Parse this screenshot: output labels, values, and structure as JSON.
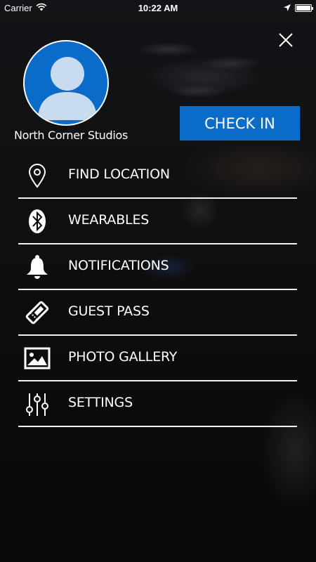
{
  "status_bar": {
    "carrier": "Carrier",
    "time": "10:22 AM",
    "battery_level": 1.0
  },
  "profile": {
    "studio_name": "North Corner Studios",
    "avatar_icon": "user-avatar-icon"
  },
  "actions": {
    "check_in_label": "CHECK IN",
    "close_icon": "close-icon"
  },
  "menu": {
    "items": [
      {
        "label": "FIND LOCATION",
        "icon": "location-pin-icon"
      },
      {
        "label": "WEARABLES",
        "icon": "bluetooth-icon"
      },
      {
        "label": "NOTIFICATIONS",
        "icon": "bell-icon"
      },
      {
        "label": "GUEST PASS",
        "icon": "ticket-icon"
      },
      {
        "label": "PHOTO GALLERY",
        "icon": "image-icon"
      },
      {
        "label": "SETTINGS",
        "icon": "sliders-icon"
      }
    ]
  },
  "colors": {
    "accent": "#0a6cc8",
    "text": "#ffffff"
  }
}
